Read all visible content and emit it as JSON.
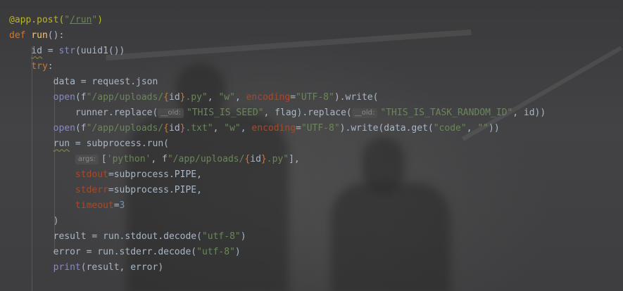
{
  "code": {
    "lines": [
      {
        "t": [
          [
            "dec",
            "@app.post("
          ],
          [
            "str",
            ""
          ],
          [
            "str-link",
            "\"/run\""
          ],
          [
            "dec",
            ")"
          ]
        ]
      },
      {
        "t": [
          [
            "kw",
            "def "
          ],
          [
            "fn",
            "run"
          ],
          [
            "p",
            "():"
          ]
        ]
      },
      {
        "t": [
          [
            "ind",
            "    "
          ],
          [
            "und",
            "id"
          ],
          [
            "p",
            " = "
          ],
          [
            "bi",
            "str"
          ],
          [
            "p",
            "(uuid1())"
          ]
        ]
      },
      {
        "t": [
          [
            "ind",
            "    "
          ],
          [
            "kw",
            "try"
          ],
          [
            "p",
            ":"
          ]
        ]
      },
      {
        "t": [
          [
            "ind",
            "        "
          ],
          [
            "p",
            "data = request.json"
          ]
        ]
      },
      {
        "t": [
          [
            "ind",
            "        "
          ],
          [
            "bi",
            "open"
          ],
          [
            "p",
            "(f"
          ],
          [
            "str",
            "\"/app/uploads/"
          ],
          [
            "brace",
            "{"
          ],
          [
            "p",
            "id"
          ],
          [
            "brace",
            "}"
          ],
          [
            "str",
            ".py\""
          ],
          [
            "p",
            ", "
          ],
          [
            "str",
            "\"w\""
          ],
          [
            "p",
            ", "
          ],
          [
            "param",
            "encoding"
          ],
          [
            "p",
            "="
          ],
          [
            "str",
            "\"UTF-8\""
          ],
          [
            "p",
            ").write("
          ]
        ]
      },
      {
        "t": [
          [
            "ind",
            "            "
          ],
          [
            "p",
            "runner.replace("
          ],
          [
            "hint",
            "__old:"
          ],
          [
            "str",
            "\"THIS_IS_SEED\""
          ],
          [
            "p",
            ", flag).replace("
          ],
          [
            "hint",
            "__old:"
          ],
          [
            "str",
            "\"THIS_IS_TASK_RANDOM_ID\""
          ],
          [
            "p",
            ", id))"
          ]
        ]
      },
      {
        "t": [
          [
            "ind",
            "        "
          ],
          [
            "bi",
            "open"
          ],
          [
            "p",
            "(f"
          ],
          [
            "str",
            "\"/app/uploads/"
          ],
          [
            "brace",
            "{"
          ],
          [
            "p",
            "id"
          ],
          [
            "brace",
            "}"
          ],
          [
            "str",
            ".txt\""
          ],
          [
            "p",
            ", "
          ],
          [
            "str",
            "\"w\""
          ],
          [
            "p",
            ", "
          ],
          [
            "param",
            "encoding"
          ],
          [
            "p",
            "="
          ],
          [
            "str",
            "\"UTF-8\""
          ],
          [
            "p",
            ").write(data.get("
          ],
          [
            "str",
            "\"code\""
          ],
          [
            "p",
            ", "
          ],
          [
            "str",
            "\"\""
          ],
          [
            "p",
            "))"
          ]
        ]
      },
      {
        "t": [
          [
            "ind",
            "        "
          ],
          [
            "und",
            "run"
          ],
          [
            "p",
            " = subprocess.run("
          ]
        ]
      },
      {
        "t": [
          [
            "ind",
            "            "
          ],
          [
            "hint",
            "args:"
          ],
          [
            "p",
            "["
          ],
          [
            "str",
            "'python'"
          ],
          [
            "p",
            ", f"
          ],
          [
            "str",
            "\"/app/uploads/"
          ],
          [
            "brace",
            "{"
          ],
          [
            "p",
            "id"
          ],
          [
            "brace",
            "}"
          ],
          [
            "str",
            ".py\""
          ],
          [
            "p",
            "],"
          ]
        ]
      },
      {
        "t": [
          [
            "ind",
            "            "
          ],
          [
            "param",
            "stdout"
          ],
          [
            "p",
            "=subprocess.PIPE,"
          ]
        ]
      },
      {
        "t": [
          [
            "ind",
            "            "
          ],
          [
            "param",
            "stderr"
          ],
          [
            "p",
            "=subprocess.PIPE,"
          ]
        ]
      },
      {
        "t": [
          [
            "ind",
            "            "
          ],
          [
            "param",
            "timeout"
          ],
          [
            "p",
            "="
          ],
          [
            "num",
            "3"
          ]
        ]
      },
      {
        "t": [
          [
            "ind",
            "        "
          ],
          [
            "p",
            ")"
          ]
        ]
      },
      {
        "t": [
          [
            "ind",
            "        "
          ],
          [
            "p",
            "result = run.stdout.decode("
          ],
          [
            "str",
            "\"utf-8\""
          ],
          [
            "p",
            ")"
          ]
        ]
      },
      {
        "t": [
          [
            "ind",
            "        "
          ],
          [
            "p",
            "error = run.stderr.decode("
          ],
          [
            "str",
            "\"utf-8\""
          ],
          [
            "p",
            ")"
          ]
        ]
      },
      {
        "t": [
          [
            "ind",
            "        "
          ],
          [
            "bi",
            "print"
          ],
          [
            "p",
            "(result, error)"
          ]
        ]
      }
    ]
  },
  "colors": {
    "background": "#3b3b3d",
    "text": "#a9b7c6",
    "keyword": "#cc7832",
    "string": "#6a8759",
    "function": "#ffc66d",
    "decorator": "#bbb529",
    "builtin": "#8888c6",
    "parameter": "#aa4926",
    "number": "#6897bb"
  }
}
